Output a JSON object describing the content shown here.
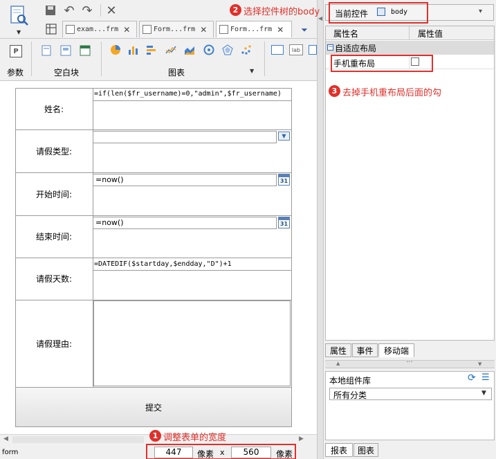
{
  "toolbar": {
    "param_group_label": "参数",
    "blank_group_label": "空白块",
    "chart_group_label": "图表",
    "text_icon_label": "lab"
  },
  "tabs": [
    {
      "label": "exam...frm"
    },
    {
      "label": "Form...frm"
    },
    {
      "label": "Form...frm"
    }
  ],
  "form": {
    "rows": [
      {
        "label": "姓名:",
        "value": "=if(len($fr_username)=0,\"admin\",$fr_username)"
      },
      {
        "label": "请假类型:",
        "value": ""
      },
      {
        "label": "开始时间:",
        "value": "=now()"
      },
      {
        "label": "结束时间:",
        "value": "=now()"
      },
      {
        "label": "请假天数:",
        "value": "=DATEDIF($startday,$endday,\"D\")+1"
      },
      {
        "label": "请假理由:",
        "value": ""
      }
    ],
    "submit_label": "提交",
    "calendar_day": "31"
  },
  "status": {
    "mode": "form",
    "width": "447",
    "height": "560",
    "unit": "像素",
    "times": "x"
  },
  "right_panel": {
    "current_label": "当前控件",
    "current_value": "body",
    "col_name": "属性名",
    "col_value": "属性值",
    "section": "自适应布局",
    "property": "手机重布局",
    "prop_tabs": [
      "属性",
      "事件",
      "移动端"
    ],
    "lib_title": "本地组件库",
    "lib_select": "所有分类",
    "bottom_tabs": [
      "报表",
      "图表"
    ]
  },
  "annotations": {
    "n1": "1",
    "t1": "调整表单的宽度",
    "n2": "2",
    "t2": "选择控件树的body",
    "n3": "3",
    "t3": "去掉手机重布局后面的勾"
  },
  "colors": {
    "annotation": "#e0302a",
    "accent": "#1d6fc4"
  }
}
